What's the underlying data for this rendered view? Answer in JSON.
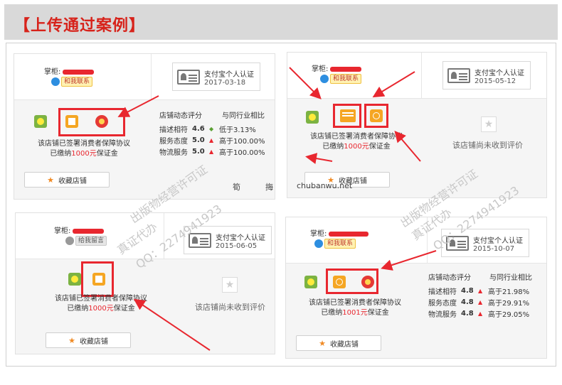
{
  "title": "【上传通过案例】",
  "colors": {
    "accent": "#e8272f",
    "header_bg": "#d9d9d9",
    "money": "#e8272f",
    "arrow": "#e8272f"
  },
  "common": {
    "owner_label": "掌柜:",
    "contact_label": "和我联系",
    "leave_msg_label": "给我留言",
    "cert_title": "支付宝个人认证",
    "agreement_line": "该店铺已签署消费者保障协议",
    "deposit_prefix": "已缴纳",
    "deposit_suffix": "保证金",
    "fav_label": "收藏店铺",
    "rating_head": "店铺动态评分",
    "compare_head": "与同行业相比",
    "no_rating": "该店铺尚未收到评价"
  },
  "panels": [
    {
      "cert_date": "2017-03-18",
      "deposit": "1000元",
      "ratings": [
        {
          "label": "描述相符",
          "score": "4.6",
          "dir": "down",
          "compare": "低于3.13%"
        },
        {
          "label": "服务态度",
          "score": "5.0",
          "dir": "up",
          "compare": "高于100.00%"
        },
        {
          "label": "物流服务",
          "score": "5.0",
          "dir": "up",
          "compare": "高于100.00%"
        }
      ]
    },
    {
      "cert_date": "2015-05-12",
      "deposit": "1000元"
    },
    {
      "cert_date": "2015-06-05",
      "deposit": "1000元"
    },
    {
      "cert_date": "2015-10-07",
      "deposit": "1001元",
      "ratings": [
        {
          "label": "描述相符",
          "score": "4.8",
          "dir": "up",
          "compare": "高于21.98%"
        },
        {
          "label": "服务态度",
          "score": "4.8",
          "dir": "up",
          "compare": "高于29.91%"
        },
        {
          "label": "物流服务",
          "score": "4.8",
          "dir": "up",
          "compare": "高于29.05%"
        }
      ]
    }
  ],
  "watermarks": {
    "line1": "出版物经营许可证",
    "line2": "真证代办",
    "line3": "QQ：2274941923",
    "site": "chubanwu.net",
    "char1": "筍",
    "char2": "挴"
  }
}
